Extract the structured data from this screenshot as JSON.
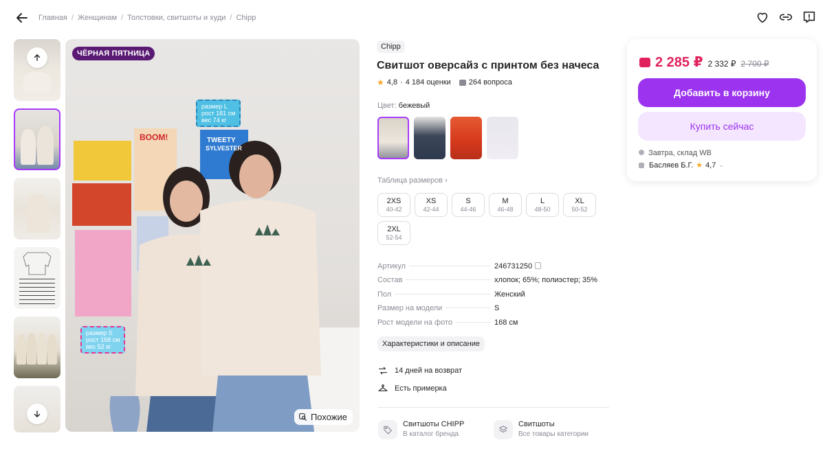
{
  "breadcrumbs": [
    "Главная",
    "Женщинам",
    "Толстовки, свитшоты и худи",
    "Chipp"
  ],
  "gallery": {
    "badge": "ЧЁРНАЯ ПЯТНИЦА",
    "similar_label": "Похожие",
    "sign_top": [
      "размер L",
      "рост 181 см",
      "вес 74 кг"
    ],
    "sign_bottom": [
      "размер S",
      "рост 168 см",
      "вес 52 кг"
    ],
    "poster_text": [
      "BOOM!",
      "TWEETY",
      "SYLVESTER"
    ]
  },
  "product": {
    "brand": "Chipp",
    "title": "Свитшот оверсайз с принтом без начеса",
    "rating": "4,8",
    "reviews": "4 184 оценки",
    "questions": "264 вопроса",
    "color_label": "Цвет:",
    "color_value": "бежевый",
    "size_table_label": "Таблица размеров",
    "sizes": [
      {
        "name": "2XS",
        "range": "40-42"
      },
      {
        "name": "XS",
        "range": "42-44"
      },
      {
        "name": "S",
        "range": "44-46"
      },
      {
        "name": "M",
        "range": "46-48"
      },
      {
        "name": "L",
        "range": "48-50"
      },
      {
        "name": "XL",
        "range": "50-52"
      },
      {
        "name": "2XL",
        "range": "52-54"
      }
    ],
    "params": [
      {
        "key": "Артикул",
        "value": "246731250"
      },
      {
        "key": "Состав",
        "value": "хлопок; 65%; полиэстер; 35%"
      },
      {
        "key": "Пол",
        "value": "Женский"
      },
      {
        "key": "Размер на модели",
        "value": "S"
      },
      {
        "key": "Рост модели на фото",
        "value": "168 см"
      }
    ],
    "char_button": "Характеристики и описание",
    "return_text": "14 дней на возврат",
    "fitting_text": "Есть примерка",
    "cat_brand_title": "Свитшоты CHIPP",
    "cat_brand_sub": "В каталог бренда",
    "cat_all_title": "Свитшоты",
    "cat_all_sub": "Все товары категории"
  },
  "card": {
    "price": "2 285 ₽",
    "price_alt": "2 332 ₽",
    "price_old": "2 700 ₽",
    "cart_button": "Добавить в корзину",
    "buy_button": "Купить сейчас",
    "delivery": "Завтра, склад WB",
    "seller": "Басляев Б.Г.",
    "seller_rating": "4,7"
  },
  "colors": {
    "accent": "#9b33ef",
    "price": "#e1215c",
    "badge": "#5a1a73"
  }
}
